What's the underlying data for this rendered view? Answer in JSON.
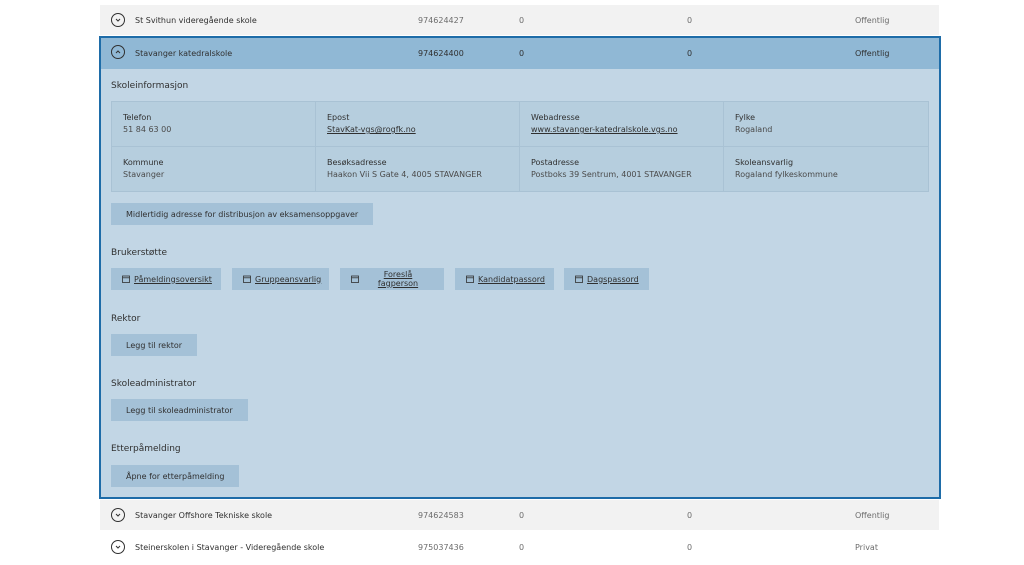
{
  "rows_top": [
    {
      "name": "St Svithun videregående skole",
      "orgnr": "974624427",
      "c1": "0",
      "c2": "0",
      "status": "Offentlig"
    }
  ],
  "expanded": {
    "name": "Stavanger katedralskole",
    "orgnr": "974624400",
    "c1": "0",
    "c2": "0",
    "status": "Offentlig",
    "skoleinfo_title": "Skoleinformasjon",
    "info": {
      "telefon_label": "Telefon",
      "telefon_value": "51 84 63 00",
      "epost_label": "Epost",
      "epost_value": "StavKat-vgs@rogfk.no",
      "web_label": "Webadresse",
      "web_value": "www.stavanger-katedralskole.vgs.no",
      "fylke_label": "Fylke",
      "fylke_value": "Rogaland",
      "kommune_label": "Kommune",
      "kommune_value": "Stavanger",
      "besok_label": "Besøksadresse",
      "besok_value": "Haakon Vii S Gate 4, 4005 STAVANGER",
      "post_label": "Postadresse",
      "post_value": "Postboks 39 Sentrum, 4001 STAVANGER",
      "ansvarlig_label": "Skoleansvarlig",
      "ansvarlig_value": "Rogaland fylkeskommune"
    },
    "midlertidig_button": "Midlertidig adresse for distribusjon av eksamensoppgaver",
    "brukerstotte_title": "Brukerstøtte",
    "brukerstotte_links": {
      "pamelding": "Påmeldingsoversikt",
      "gruppe": "Gruppeansvarlig",
      "fagperson": "Foreslå fagperson",
      "kandidat": "Kandidatpassord",
      "dags": "Dagspassord"
    },
    "rektor_title": "Rektor",
    "rektor_button": "Legg til rektor",
    "skoleadmin_title": "Skoleadministrator",
    "skoleadmin_button": "Legg til skoleadministrator",
    "etter_title": "Etterpåmelding",
    "etter_button": "Åpne for etterpåmelding"
  },
  "rows_bottom": [
    {
      "name": "Stavanger Offshore Tekniske skole",
      "orgnr": "974624583",
      "c1": "0",
      "c2": "0",
      "status": "Offentlig"
    },
    {
      "name": "Steinerskolen i Stavanger - Videregående skole",
      "orgnr": "975037436",
      "c1": "0",
      "c2": "0",
      "status": "Privat"
    }
  ],
  "colors": {
    "accent_border": "#1e6ca8",
    "expanded_bg": "#c2d6e5",
    "header_bg": "#90b8d5",
    "button_bg": "#a4c1d7"
  },
  "icons": {
    "toggle_collapsed": "chevron-down-icon",
    "toggle_expanded": "chevron-up-icon",
    "link_icon": "calendar-icon"
  }
}
